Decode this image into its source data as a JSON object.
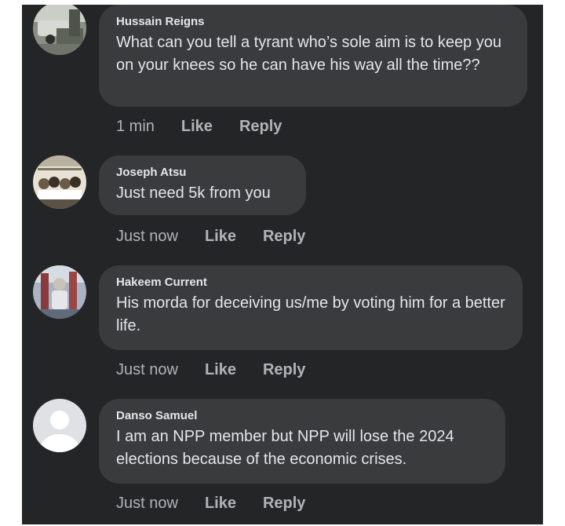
{
  "comments": [
    {
      "author": "Hussain Reigns",
      "text": "What can you tell a tyrant who’s sole aim is to keep you on your knees so he can have his way all the time??",
      "time": "1 min",
      "like_label": "Like",
      "reply_label": "Reply"
    },
    {
      "author": "Joseph Atsu",
      "text": "Just need 5k from you",
      "time": "Just now",
      "like_label": "Like",
      "reply_label": "Reply"
    },
    {
      "author": "Hakeem Current",
      "text": "His morda for deceiving us/me by voting him for a better life.",
      "time": "Just now",
      "like_label": "Like",
      "reply_label": "Reply"
    },
    {
      "author": "Danso Samuel",
      "text": "I am an NPP member but NPP will lose the 2024 elections because of the economic crises.",
      "time": "Just now",
      "like_label": "Like",
      "reply_label": "Reply"
    }
  ],
  "colors": {
    "background": "#242526",
    "bubble": "#3a3b3c",
    "primary_text": "#e4e6eb",
    "secondary_text": "#b0b3b8"
  }
}
